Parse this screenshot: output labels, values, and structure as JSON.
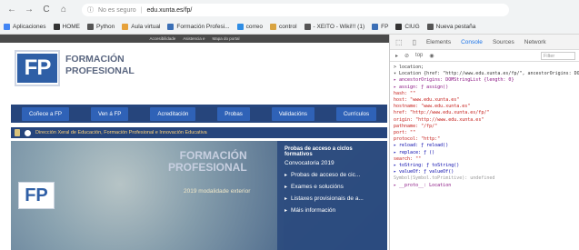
{
  "browser": {
    "nav": {
      "back": "←",
      "forward": "→",
      "reload": "C",
      "home": "⌂"
    },
    "omnibox": {
      "info_icon": "ⓘ",
      "security": "No es seguro",
      "separator": "|",
      "url": "edu.xunta.es/fp/"
    },
    "bookmarks": [
      {
        "label": "Aplicaciones",
        "color": "#4285f4"
      },
      {
        "label": "HOME",
        "color": "#333333"
      },
      {
        "label": "Python",
        "color": "#555555"
      },
      {
        "label": "Aula virtual",
        "color": "#e6a13a"
      },
      {
        "label": "Formación Profesi...",
        "color": "#3b6fb6"
      },
      {
        "label": "correo",
        "color": "#2f8de4"
      },
      {
        "label": "control",
        "color": "#d9a441"
      },
      {
        "label": "- XEITO - Wiki!!! (1)",
        "color": "#555555"
      },
      {
        "label": "FP",
        "color": "#3b6fb6"
      },
      {
        "label": "CIUG",
        "color": "#333333"
      },
      {
        "label": "Nueva pestaña",
        "color": "#555555"
      }
    ]
  },
  "page": {
    "accessibility_bar": [
      "Accesibilidade",
      "Asistencia e",
      "Mapa do portal"
    ],
    "logo_letters": "FP",
    "brand_line1": "FORMACIÓN",
    "brand_line2": "PROFESIONAL",
    "nav": [
      "Coñece a FP",
      "Ven á FP",
      "Acreditación",
      "Probas",
      "Validacións",
      "Currículos"
    ],
    "ministry": "Dirección Xeral de Educación, Formación Profesional e Innovación Educativa",
    "hero": {
      "logo_letters": "FP",
      "banner_line1": "FORMACIÓN",
      "banner_line2": "PROFESIONAL",
      "sub": "modalidade exterior",
      "badge": "2019"
    },
    "promo": {
      "title": "Probas de acceso a ciclos formativos",
      "subtitle": "Convocatoria 2019",
      "links": [
        "Probas de acceso de cic...",
        "Exames e solucións",
        "Listaxes provisionais de a...",
        "Máis información"
      ]
    }
  },
  "devtools": {
    "tabs": [
      "Elements",
      "Console",
      "Sources",
      "Network"
    ],
    "active_tab": "Console",
    "context": "top",
    "filter_placeholder": "Filter",
    "lines": [
      {
        "text": "> location;",
        "cls": "d"
      },
      {
        "text": "▾ Location {href: \"http://www.edu.xunta.es/fp/\", ancestorOrigins: DOMStringList, origin: \"http://www.edu.xunta.es\", protocol: ...}",
        "cls": "d"
      },
      {
        "text": "  ▸ ancestorOrigins: DOMStringList {length: 0}",
        "cls": "k"
      },
      {
        "text": "  ▸ assign: ƒ assign()",
        "cls": "k"
      },
      {
        "text": "    hash: \"\"",
        "cls": "s"
      },
      {
        "text": "    host: \"www.edu.xunta.es\"",
        "cls": "s"
      },
      {
        "text": "    hostname: \"www.edu.xunta.es\"",
        "cls": "s"
      },
      {
        "text": "    href: \"http://www.edu.xunta.es/fp/\"",
        "cls": "s"
      },
      {
        "text": "    origin: \"http://www.edu.xunta.es\"",
        "cls": "s"
      },
      {
        "text": "    pathname: \"/fp/\"",
        "cls": "s"
      },
      {
        "text": "    port: \"\"",
        "cls": "s"
      },
      {
        "text": "    protocol: \"http:\"",
        "cls": "s"
      },
      {
        "text": "  ▸ reload: ƒ reload()",
        "cls": "f"
      },
      {
        "text": "  ▸ replace: ƒ ()",
        "cls": "f"
      },
      {
        "text": "    search: \"\"",
        "cls": "s"
      },
      {
        "text": "  ▸ toString: ƒ toString()",
        "cls": "f"
      },
      {
        "text": "  ▸ valueOf: ƒ valueOf()",
        "cls": "f"
      },
      {
        "text": "    Symbol(Symbol.toPrimitive): undefined",
        "cls": "g"
      },
      {
        "text": "  ▸ __proto__: Location",
        "cls": "k"
      }
    ]
  }
}
